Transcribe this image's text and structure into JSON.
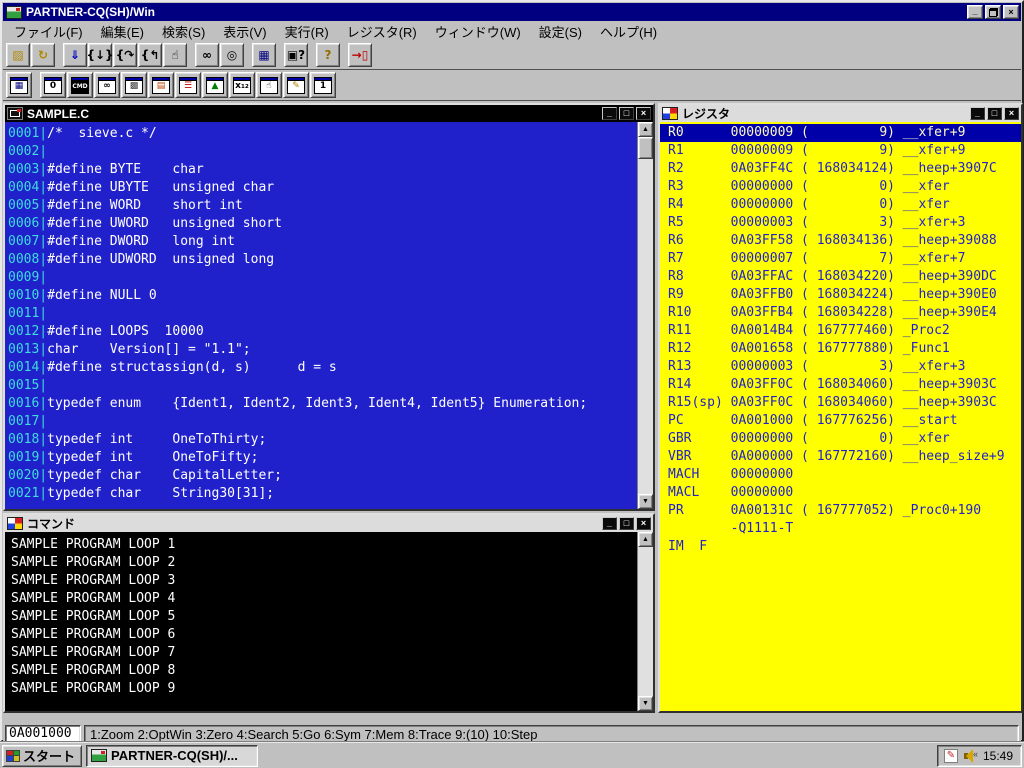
{
  "colors": {
    "titlebar": "#000080",
    "chrome": "#c0c0c0",
    "source_bg": "#2121cc",
    "source_text": "#ffffff",
    "source_linenum": "#3ddddd",
    "register_bg": "#ffff00",
    "register_text": "#2222cc",
    "register_highlight_bg": "#0000a8",
    "register_highlight_text": "#fff8c8",
    "command_bg": "#000000",
    "command_text": "#ffffff"
  },
  "window": {
    "title": "PARTNER-CQ(SH)/Win"
  },
  "window_controls": {
    "minimize_glyph": "_",
    "maximize_glyph": "□",
    "close_glyph": "×"
  },
  "menu": {
    "items": [
      {
        "id": "file",
        "label": "ファイル(F)"
      },
      {
        "id": "edit",
        "label": "編集(E)"
      },
      {
        "id": "search",
        "label": "検索(S)"
      },
      {
        "id": "view",
        "label": "表示(V)"
      },
      {
        "id": "run",
        "label": "実行(R)"
      },
      {
        "id": "register",
        "label": "レジスタ(R)"
      },
      {
        "id": "window",
        "label": "ウィンドウ(W)"
      },
      {
        "id": "settings",
        "label": "設定(S)"
      },
      {
        "id": "help",
        "label": "ヘルプ(H)"
      }
    ]
  },
  "toolbar_main": {
    "buttons": [
      {
        "id": "open-file",
        "glyph": "▨",
        "fg": "#b08800",
        "group": 1
      },
      {
        "id": "reload-file",
        "glyph": "↻",
        "fg": "#b08800",
        "group": 1
      },
      {
        "id": "load-module",
        "glyph": "⇓",
        "fg": "#0000c0",
        "group": 2
      },
      {
        "id": "step-into",
        "glyph": "{↓}",
        "fg": "#000000",
        "group": 2
      },
      {
        "id": "step-over",
        "glyph": "{↷",
        "fg": "#000000",
        "group": 2
      },
      {
        "id": "step-return",
        "glyph": "{↰",
        "fg": "#000000",
        "group": 2
      },
      {
        "id": "break-hand",
        "glyph": "☝",
        "fg": "#000000",
        "group": 2
      },
      {
        "id": "watch-glasses",
        "glyph": "∞",
        "fg": "#000000",
        "group": 3
      },
      {
        "id": "search-magnifier",
        "glyph": "◎",
        "fg": "#000000",
        "group": 3
      },
      {
        "id": "trace",
        "glyph": "▦",
        "fg": "#000080",
        "group": 4
      },
      {
        "id": "save-config",
        "glyph": "▣?",
        "fg": "#000000",
        "group": 5
      },
      {
        "id": "help",
        "glyph": "?",
        "fg": "#907000",
        "group": 6
      },
      {
        "id": "exit",
        "glyph": "→▯",
        "fg": "#c00000",
        "group": 7
      }
    ]
  },
  "toolbar_windows": {
    "buttons": [
      {
        "id": "trace-window",
        "glyph": "▦",
        "fg": "#000080",
        "group": 1
      },
      {
        "id": "window-0",
        "glyph": "0",
        "fg": "#000000",
        "group": 2
      },
      {
        "id": "command-window",
        "glyph": "CMD",
        "fg": "#ffffff",
        "dark": true,
        "group": 2
      },
      {
        "id": "watch-window",
        "glyph": "∞",
        "fg": "#000000",
        "group": 2
      },
      {
        "id": "memory-window",
        "glyph": "▩",
        "fg": "#404040",
        "group": 2
      },
      {
        "id": "io-window",
        "glyph": "▤",
        "fg": "#c04000",
        "group": 2
      },
      {
        "id": "stack-window",
        "glyph": "☰",
        "fg": "#c00000",
        "group": 2
      },
      {
        "id": "bitmap-window",
        "glyph": "▲",
        "fg": "#008000",
        "group": 2
      },
      {
        "id": "symbol-window",
        "glyph": "x₁₂",
        "fg": "#000000",
        "group": 2
      },
      {
        "id": "hand-window",
        "glyph": "☝",
        "fg": "#000000",
        "group": 2
      },
      {
        "id": "edit-window",
        "glyph": "✎",
        "fg": "#b08000",
        "group": 2
      },
      {
        "id": "window-1",
        "glyph": "1",
        "fg": "#000000",
        "group": 2
      }
    ]
  },
  "source_window": {
    "title": "SAMPLE.C",
    "lines": [
      {
        "num": "0001",
        "code": "/*  sieve.c */"
      },
      {
        "num": "0002",
        "code": ""
      },
      {
        "num": "0003",
        "code": "#define BYTE    char"
      },
      {
        "num": "0004",
        "code": "#define UBYTE   unsigned char"
      },
      {
        "num": "0005",
        "code": "#define WORD    short int"
      },
      {
        "num": "0006",
        "code": "#define UWORD   unsigned short"
      },
      {
        "num": "0007",
        "code": "#define DWORD   long int"
      },
      {
        "num": "0008",
        "code": "#define UDWORD  unsigned long"
      },
      {
        "num": "0009",
        "code": ""
      },
      {
        "num": "0010",
        "code": "#define NULL 0"
      },
      {
        "num": "0011",
        "code": ""
      },
      {
        "num": "0012",
        "code": "#define LOOPS  10000"
      },
      {
        "num": "0013",
        "code": "char    Version[] = \"1.1\";"
      },
      {
        "num": "0014",
        "code": "#define structassign(d, s)      d = s"
      },
      {
        "num": "0015",
        "code": ""
      },
      {
        "num": "0016",
        "code": "typedef enum    {Ident1, Ident2, Ident3, Ident4, Ident5} Enumeration;"
      },
      {
        "num": "0017",
        "code": ""
      },
      {
        "num": "0018",
        "code": "typedef int     OneToThirty;"
      },
      {
        "num": "0019",
        "code": "typedef int     OneToFifty;"
      },
      {
        "num": "0020",
        "code": "typedef char    CapitalLetter;"
      },
      {
        "num": "0021",
        "code": "typedef char    String30[31];"
      }
    ]
  },
  "register_window": {
    "title": "レジスタ",
    "rows": [
      {
        "name": "R0",
        "hex": "00000009",
        "dec": "9",
        "sym": "__xfer+9",
        "highlight": true
      },
      {
        "name": "R1",
        "hex": "00000009",
        "dec": "9",
        "sym": "__xfer+9"
      },
      {
        "name": "R2",
        "hex": "0A03FF4C",
        "dec": "168034124",
        "sym": "__heep+3907C"
      },
      {
        "name": "R3",
        "hex": "00000000",
        "dec": "0",
        "sym": "__xfer"
      },
      {
        "name": "R4",
        "hex": "00000000",
        "dec": "0",
        "sym": "__xfer"
      },
      {
        "name": "R5",
        "hex": "00000003",
        "dec": "3",
        "sym": "__xfer+3"
      },
      {
        "name": "R6",
        "hex": "0A03FF58",
        "dec": "168034136",
        "sym": "__heep+39088"
      },
      {
        "name": "R7",
        "hex": "00000007",
        "dec": "7",
        "sym": "__xfer+7"
      },
      {
        "name": "R8",
        "hex": "0A03FFAC",
        "dec": "168034220",
        "sym": "__heep+390DC"
      },
      {
        "name": "R9",
        "hex": "0A03FFB0",
        "dec": "168034224",
        "sym": "__heep+390E0"
      },
      {
        "name": "R10",
        "hex": "0A03FFB4",
        "dec": "168034228",
        "sym": "__heep+390E4"
      },
      {
        "name": "R11",
        "hex": "0A0014B4",
        "dec": "167777460",
        "sym": "_Proc2"
      },
      {
        "name": "R12",
        "hex": "0A001658",
        "dec": "167777880",
        "sym": "_Func1"
      },
      {
        "name": "R13",
        "hex": "00000003",
        "dec": "3",
        "sym": "__xfer+3"
      },
      {
        "name": "R14",
        "hex": "0A03FF0C",
        "dec": "168034060",
        "sym": "__heep+3903C"
      },
      {
        "name": "R15(sp)",
        "hex": "0A03FF0C",
        "dec": "168034060",
        "sym": "__heep+3903C"
      },
      {
        "name": "PC",
        "hex": "0A001000",
        "dec": "167776256",
        "sym": "__start"
      },
      {
        "name": "GBR",
        "hex": "00000000",
        "dec": "0",
        "sym": "__xfer"
      },
      {
        "name": "VBR",
        "hex": "0A000000",
        "dec": "167772160",
        "sym": "__heep_size+9"
      },
      {
        "name": "MACH",
        "hex": "00000000"
      },
      {
        "name": "MACL",
        "hex": "00000000"
      },
      {
        "name": "PR",
        "hex": "0A00131C",
        "dec": "167777052",
        "sym": "_Proc0+190"
      },
      {
        "raw": "        -Q1111-T"
      },
      {
        "name": "IM",
        "value": "F"
      }
    ]
  },
  "command_window": {
    "title": "コマンド",
    "lines": [
      "SAMPLE PROGRAM LOOP 1",
      "SAMPLE PROGRAM LOOP 2",
      "SAMPLE PROGRAM LOOP 3",
      "SAMPLE PROGRAM LOOP 4",
      "SAMPLE PROGRAM LOOP 5",
      "SAMPLE PROGRAM LOOP 6",
      "SAMPLE PROGRAM LOOP 7",
      "SAMPLE PROGRAM LOOP 8",
      "SAMPLE PROGRAM LOOP 9"
    ]
  },
  "status_bar": {
    "address": "0A001000",
    "keys": "1:Zoom 2:OptWin 3:Zero 4:Search 5:Go 6:Sym 7:Mem 8:Trace 9:(10) 10:Step"
  },
  "taskbar": {
    "start_label": "スタート",
    "task_label": "PARTNER-CQ(SH)/...",
    "clock": "15:49"
  }
}
